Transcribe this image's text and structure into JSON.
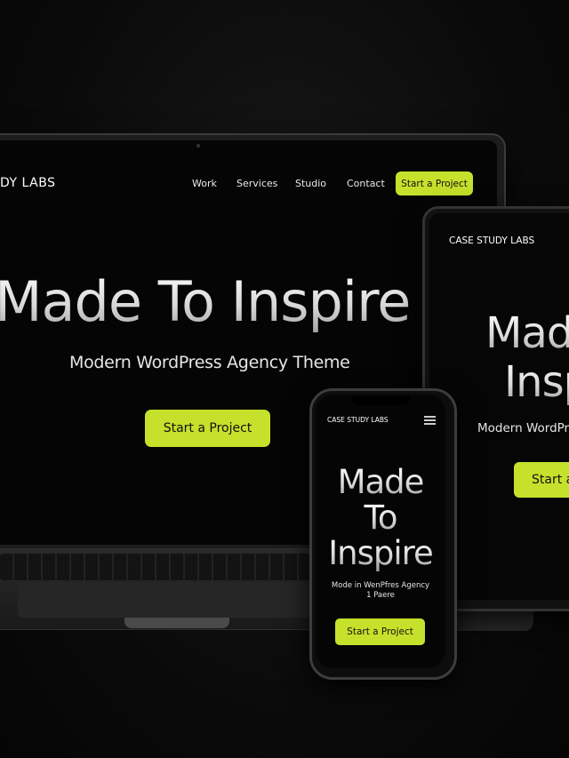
{
  "brand_color": "#c6e12b",
  "laptop": {
    "logo": "DY LABS",
    "nav": [
      "Work",
      "Services",
      "Studio",
      "Contact"
    ],
    "cta": "Start a Project",
    "headline": "Made To Inspire",
    "subheadline": "Modern WordPress Agency Theme",
    "hero_button": "Start a Project"
  },
  "tablet": {
    "logo": "CASE STUDY LABS",
    "headline_line1": "Mad",
    "headline_line2": "Insp",
    "subheadline": "Modern WordPre",
    "button": "Start a"
  },
  "phone": {
    "logo": "CASE STUDY LABS",
    "menu_icon": "hamburger-menu-icon",
    "headline_line1": "Made",
    "headline_line2": "To",
    "headline_line3": "Inspire",
    "subheadline_line1": "Mode in WenPfres Agency",
    "subheadline_line2": "1 Paere",
    "button": "Start a Project"
  }
}
